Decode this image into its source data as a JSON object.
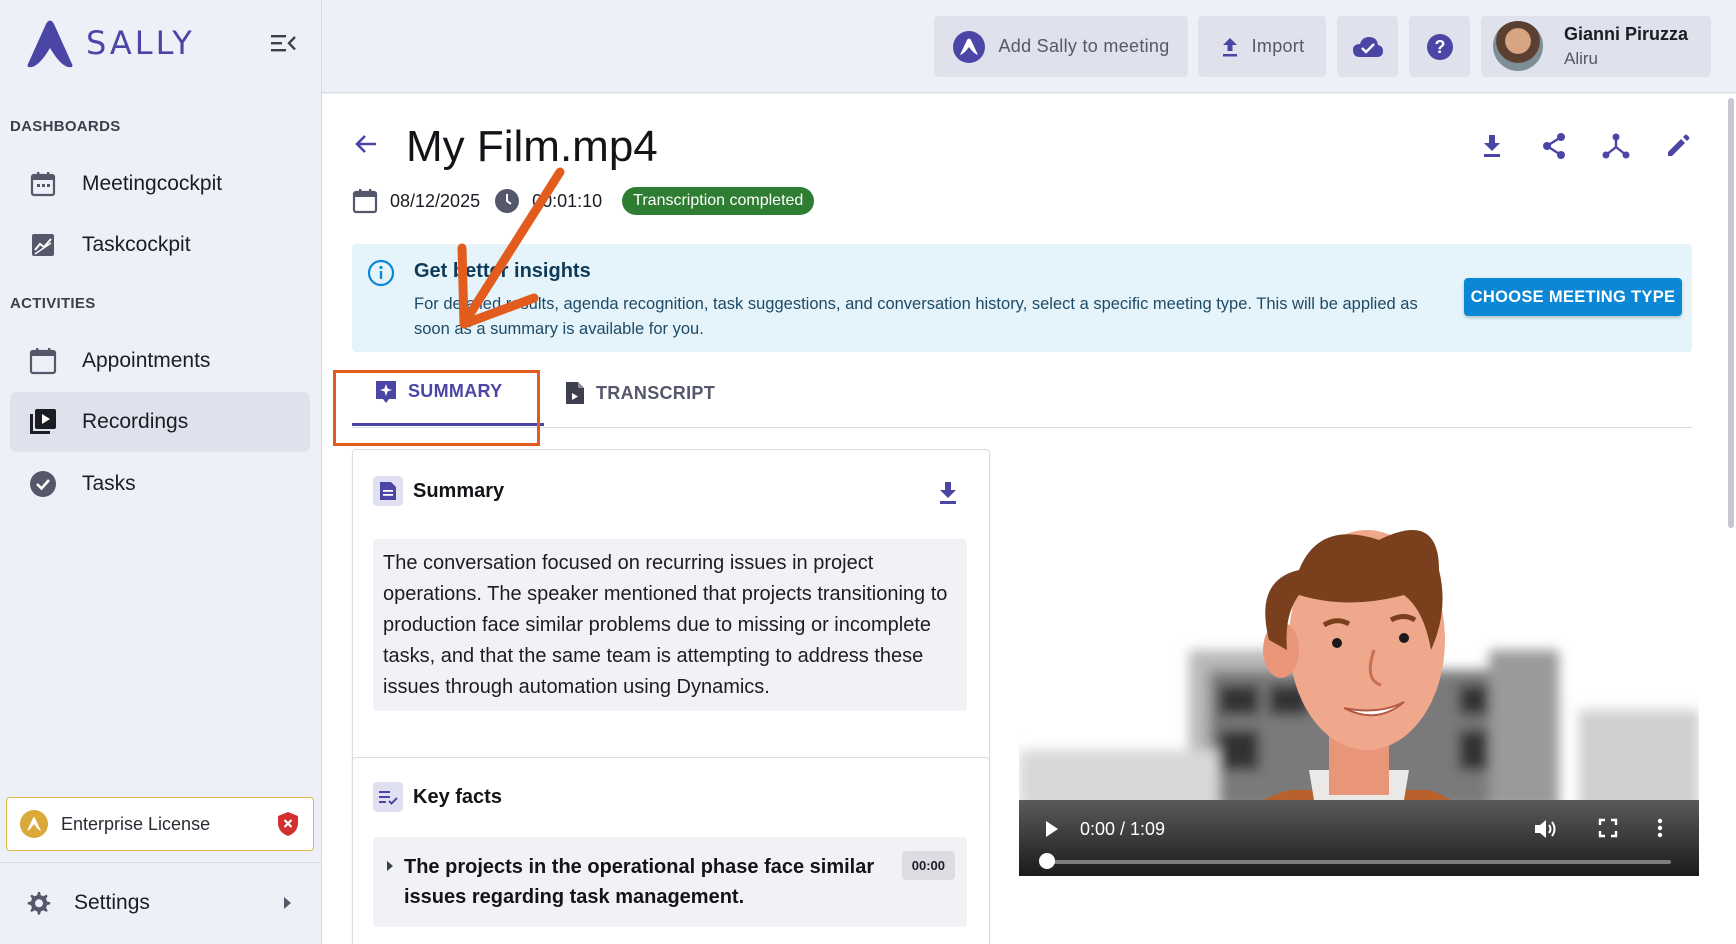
{
  "app": {
    "brand": "SALLY",
    "accent": "#4b46a6",
    "highlight_color": "#e25c1d"
  },
  "sidebar": {
    "sections": [
      {
        "label": "DASHBOARDS",
        "items": [
          {
            "label": "Meetingcockpit",
            "icon": "calendar-icon"
          },
          {
            "label": "Taskcockpit",
            "icon": "chart-icon"
          }
        ]
      },
      {
        "label": "ACTIVITIES",
        "items": [
          {
            "label": "Appointments",
            "icon": "calendar-blank-icon"
          },
          {
            "label": "Recordings",
            "icon": "video-library-icon",
            "active": true
          },
          {
            "label": "Tasks",
            "icon": "check-circle-icon"
          }
        ]
      }
    ],
    "license": "Enterprise License",
    "settings": "Settings"
  },
  "topbar": {
    "add_sally": "Add Sally to meeting",
    "import": "Import",
    "user": {
      "name": "Gianni Piruzza",
      "org": "Aliru"
    }
  },
  "page": {
    "title": "My Film.mp4",
    "date": "08/12/2025",
    "duration": "00:01:10",
    "status": "Transcription completed"
  },
  "info": {
    "title": "Get better insights",
    "text": "For detailed results, agenda recognition, task suggestions, and conversation history, select a specific meeting type. This will be applied as soon as a summary is available for you.",
    "button": "CHOOSE MEETING TYPE"
  },
  "tabs": [
    {
      "label": "SUMMARY",
      "active": true
    },
    {
      "label": "TRANSCRIPT",
      "active": false
    }
  ],
  "summary": {
    "title": "Summary",
    "text": "The conversation focused on recurring issues in project operations. The speaker mentioned that projects transitioning to production face similar problems due to missing or incomplete tasks, and that the same team is attempting to address these issues through automation using Dynamics."
  },
  "key_facts": {
    "title": "Key facts",
    "items": [
      {
        "text": "The projects in the operational phase face similar issues regarding task management.",
        "time": "00:00"
      }
    ]
  },
  "video": {
    "time": "0:00 / 1:09",
    "progress": 0
  }
}
